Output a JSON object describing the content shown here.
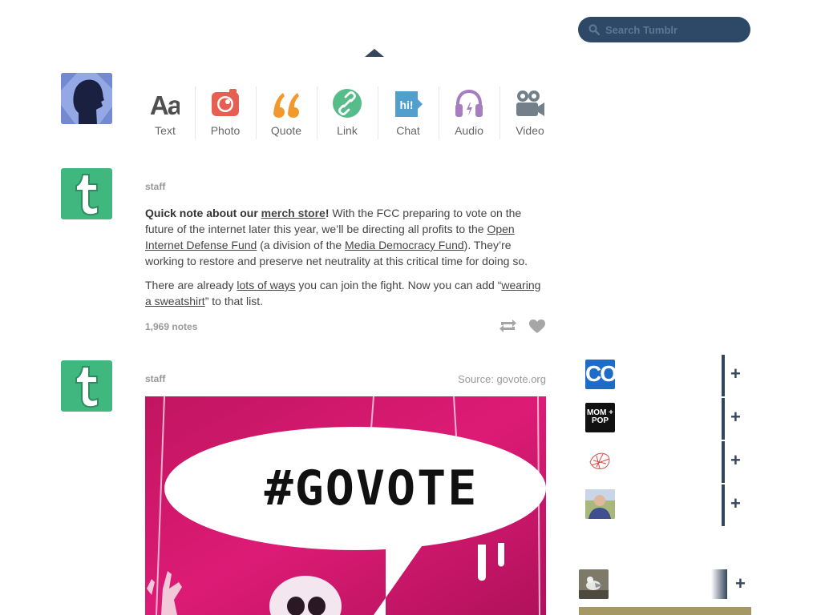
{
  "search": {
    "placeholder": "Search Tumblr"
  },
  "post_types": [
    {
      "label": "Text",
      "icon": "text-icon",
      "color": "#4f4f4f"
    },
    {
      "label": "Photo",
      "icon": "camera-icon",
      "color": "#e65f52"
    },
    {
      "label": "Quote",
      "icon": "quote-icon",
      "color": "#f2992e"
    },
    {
      "label": "Link",
      "icon": "link-icon",
      "color": "#56bc8a"
    },
    {
      "label": "Chat",
      "icon": "chat-icon",
      "color": "#529ecc"
    },
    {
      "label": "Audio",
      "icon": "headphones-icon",
      "color": "#a77dc2"
    },
    {
      "label": "Video",
      "icon": "video-camera-icon",
      "color": "#748089"
    }
  ],
  "post1": {
    "author": "staff",
    "bold_lead": "Quick note about our ",
    "link_merch": "merch store",
    "bold_end": "!",
    "text_a": " With the FCC preparing to vote on the future of the internet later this year, we’ll be directing all profits to the ",
    "link_oidf": "Open Internet Defense Fund",
    "text_b": " (a division of the ",
    "link_mdf": "Media Democracy Fund",
    "text_c": "). They’re working to restore and preserve net neutrality at this critical time for doing so.",
    "p2_a": "There are already ",
    "link_ways": "lots of ways",
    "p2_b": " you can join the fight. Now you can add “",
    "link_sweat": "wearing a sweatshirt",
    "p2_c": "” to that list.",
    "notes": "1,969 notes"
  },
  "post2": {
    "author": "staff",
    "source": "Source: govote.org",
    "image_text": "#GOVOTE"
  },
  "recommended": [
    {
      "name": "co-avatar",
      "label": "CO"
    },
    {
      "name": "mompop-avatar",
      "label": "MOM + POP"
    },
    {
      "name": "sketch-avatar",
      "label": ""
    },
    {
      "name": "person-avatar",
      "label": ""
    }
  ],
  "colors": {
    "navy": "#35465c",
    "tumblr_green": "#3fb77f",
    "magenta": "#d2166e"
  }
}
